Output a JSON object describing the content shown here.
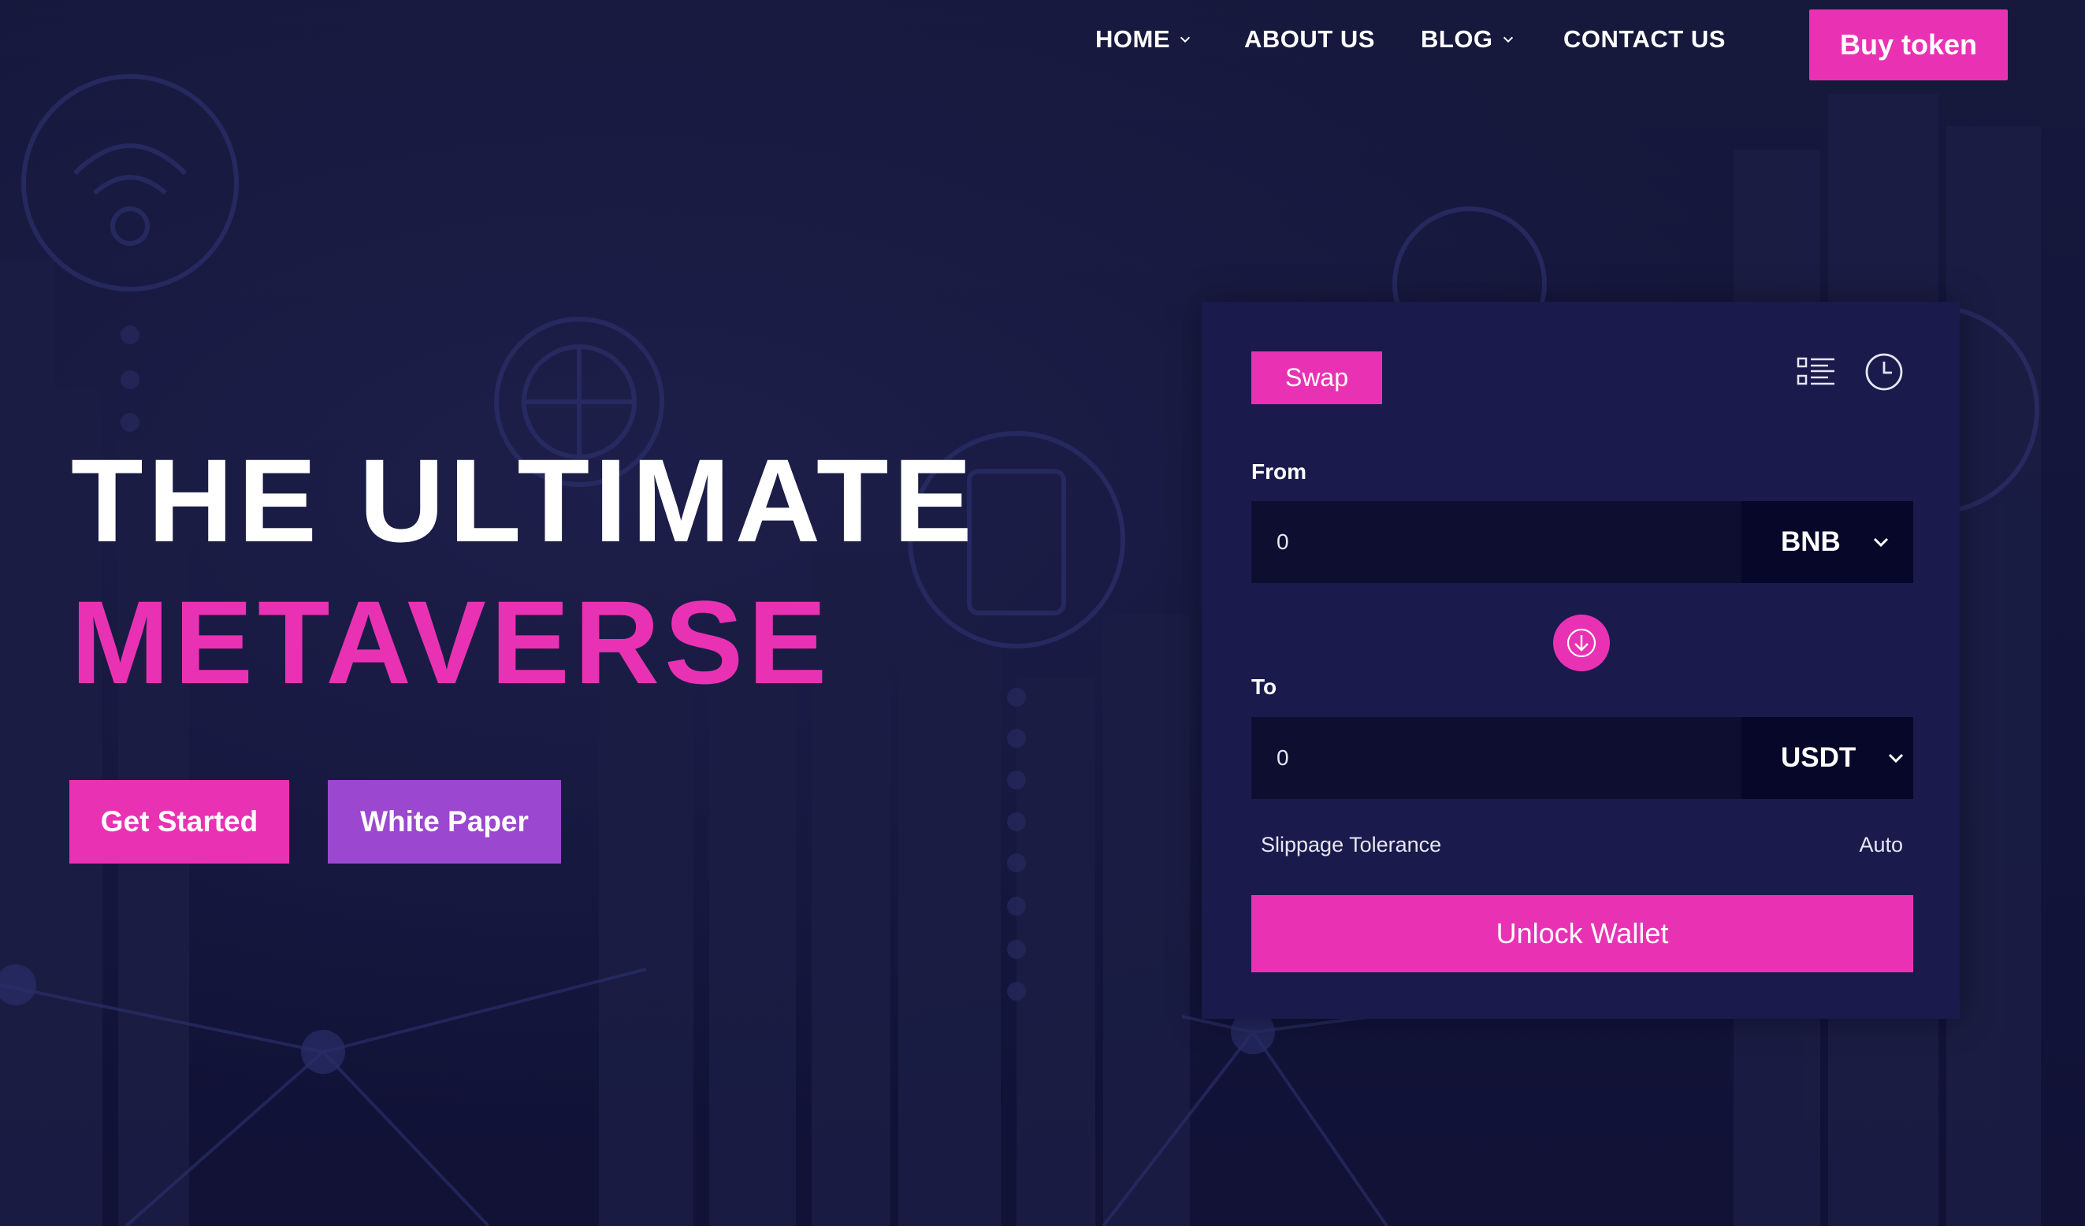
{
  "colors": {
    "background": "#15163a",
    "accent_pink": "#e932b3",
    "accent_purple": "#9b47cf",
    "card": "#1a1a4d",
    "field": "#0e0e30"
  },
  "nav": {
    "items": [
      {
        "label": "HOME",
        "has_dropdown": true
      },
      {
        "label": "ABOUT US",
        "has_dropdown": false
      },
      {
        "label": "BLOG",
        "has_dropdown": true
      },
      {
        "label": "CONTACT US",
        "has_dropdown": false
      }
    ],
    "cta_label": "Buy token"
  },
  "hero": {
    "title_line1": "THE ULTIMATE",
    "title_line2": "METAVERSE",
    "primary_button": "Get Started",
    "secondary_button": "White Paper"
  },
  "swap": {
    "tab_label": "Swap",
    "icons": [
      "list-settings-icon",
      "clock-history-icon"
    ],
    "from": {
      "label": "From",
      "value": "0",
      "token": "BNB"
    },
    "to": {
      "label": "To",
      "value": "0",
      "token": "USDT"
    },
    "direction_icon": "arrow-down-icon",
    "slippage_label": "Slippage Tolerance",
    "slippage_value": "Auto",
    "unlock_button": "Unlock Wallet"
  }
}
